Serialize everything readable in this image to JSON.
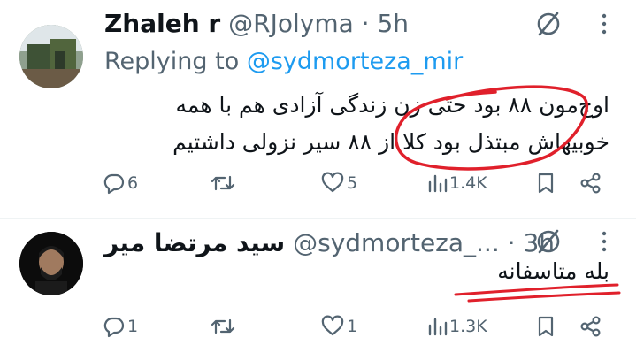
{
  "tweets": [
    {
      "display_name": "Zhaleh r",
      "handle": "@RJolyma",
      "separator": "·",
      "time": "5h",
      "replying_prefix": "Replying to",
      "replying_handle": "@sydmorteza_mir",
      "lines": [
        "اوج‌مون ۸۸ بود حتی زن زندگی آزادی هم با همه",
        "خوبیهاش مبتذل بود کلا از ۸۸ سیر نزولی داشتیم"
      ],
      "replies": "6",
      "reposts": "",
      "likes": "5",
      "views": "1.4K"
    },
    {
      "display_name": "سید مرتضا میر",
      "handle": "@sydmorteza_...",
      "separator": "·",
      "time": "3h",
      "lines": [
        "بله متاسفانه"
      ],
      "replies": "1",
      "reposts": "",
      "likes": "1",
      "views": "1.3K"
    }
  ],
  "icons": {
    "grok": "grok-slash-icon",
    "more": "more-vertical-icon",
    "reply": "reply-bubble-icon",
    "repost": "repost-icon",
    "like": "heart-icon",
    "views": "views-bar-icon",
    "bookmark": "bookmark-icon",
    "share": "share-icon"
  },
  "colors": {
    "text": "#0f1419",
    "muted": "#536471",
    "link": "#1d9bf0",
    "annotation": "#e0202b",
    "divider": "#eff3f4"
  }
}
